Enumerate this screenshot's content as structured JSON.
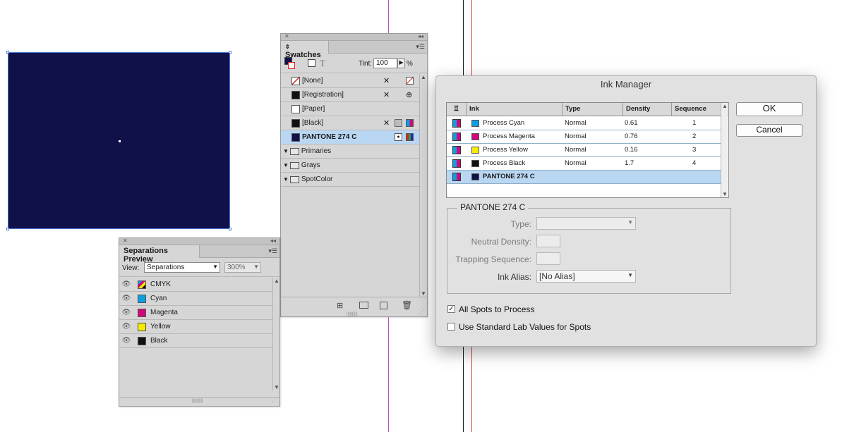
{
  "swatches_panel": {
    "title": "Swatches",
    "tint_label": "Tint:",
    "tint_value": "100",
    "percent": "%",
    "items": [
      {
        "label": "[None]"
      },
      {
        "label": "[Registration]"
      },
      {
        "label": "[Paper]"
      },
      {
        "label": "[Black]"
      },
      {
        "label": "PANTONE 274 C"
      },
      {
        "label": "Primaries"
      },
      {
        "label": "Grays"
      },
      {
        "label": "SpotColor"
      }
    ]
  },
  "separations_panel": {
    "title": "Separations Preview",
    "view_label": "View:",
    "view_value": "Separations",
    "zoom_value": "300%",
    "inks": [
      {
        "label": "CMYK"
      },
      {
        "label": "Cyan"
      },
      {
        "label": "Magenta"
      },
      {
        "label": "Yellow"
      },
      {
        "label": "Black"
      }
    ]
  },
  "ink_manager": {
    "title": "Ink Manager",
    "columns": [
      "Ink",
      "Type",
      "Density",
      "Sequence"
    ],
    "rows": [
      {
        "ink": "Process Cyan",
        "type": "Normal",
        "density": "0.61",
        "sequence": "1"
      },
      {
        "ink": "Process Magenta",
        "type": "Normal",
        "density": "0.76",
        "sequence": "2"
      },
      {
        "ink": "Process Yellow",
        "type": "Normal",
        "density": "0.16",
        "sequence": "3"
      },
      {
        "ink": "Process Black",
        "type": "Normal",
        "density": "1.7",
        "sequence": "4"
      },
      {
        "ink": "PANTONE 274 C",
        "type": "",
        "density": "",
        "sequence": ""
      }
    ],
    "ok_label": "OK",
    "cancel_label": "Cancel",
    "group_title": "PANTONE 274 C",
    "type_label": "Type:",
    "neutral_density_label": "Neutral Density:",
    "trapping_sequence_label": "Trapping Sequence:",
    "ink_alias_label": "Ink Alias:",
    "ink_alias_value": "[No Alias]",
    "all_spots_label": "All Spots to Process",
    "all_spots_checked": true,
    "lab_values_label": "Use Standard Lab Values for Spots",
    "lab_values_checked": false
  },
  "colors": {
    "pantone_274c": "#11114a",
    "cyan": "#0aa0e0",
    "magenta": "#d0087a",
    "yellow": "#f5ec00",
    "black": "#111111",
    "selection_blue": "#b9d7f2"
  }
}
